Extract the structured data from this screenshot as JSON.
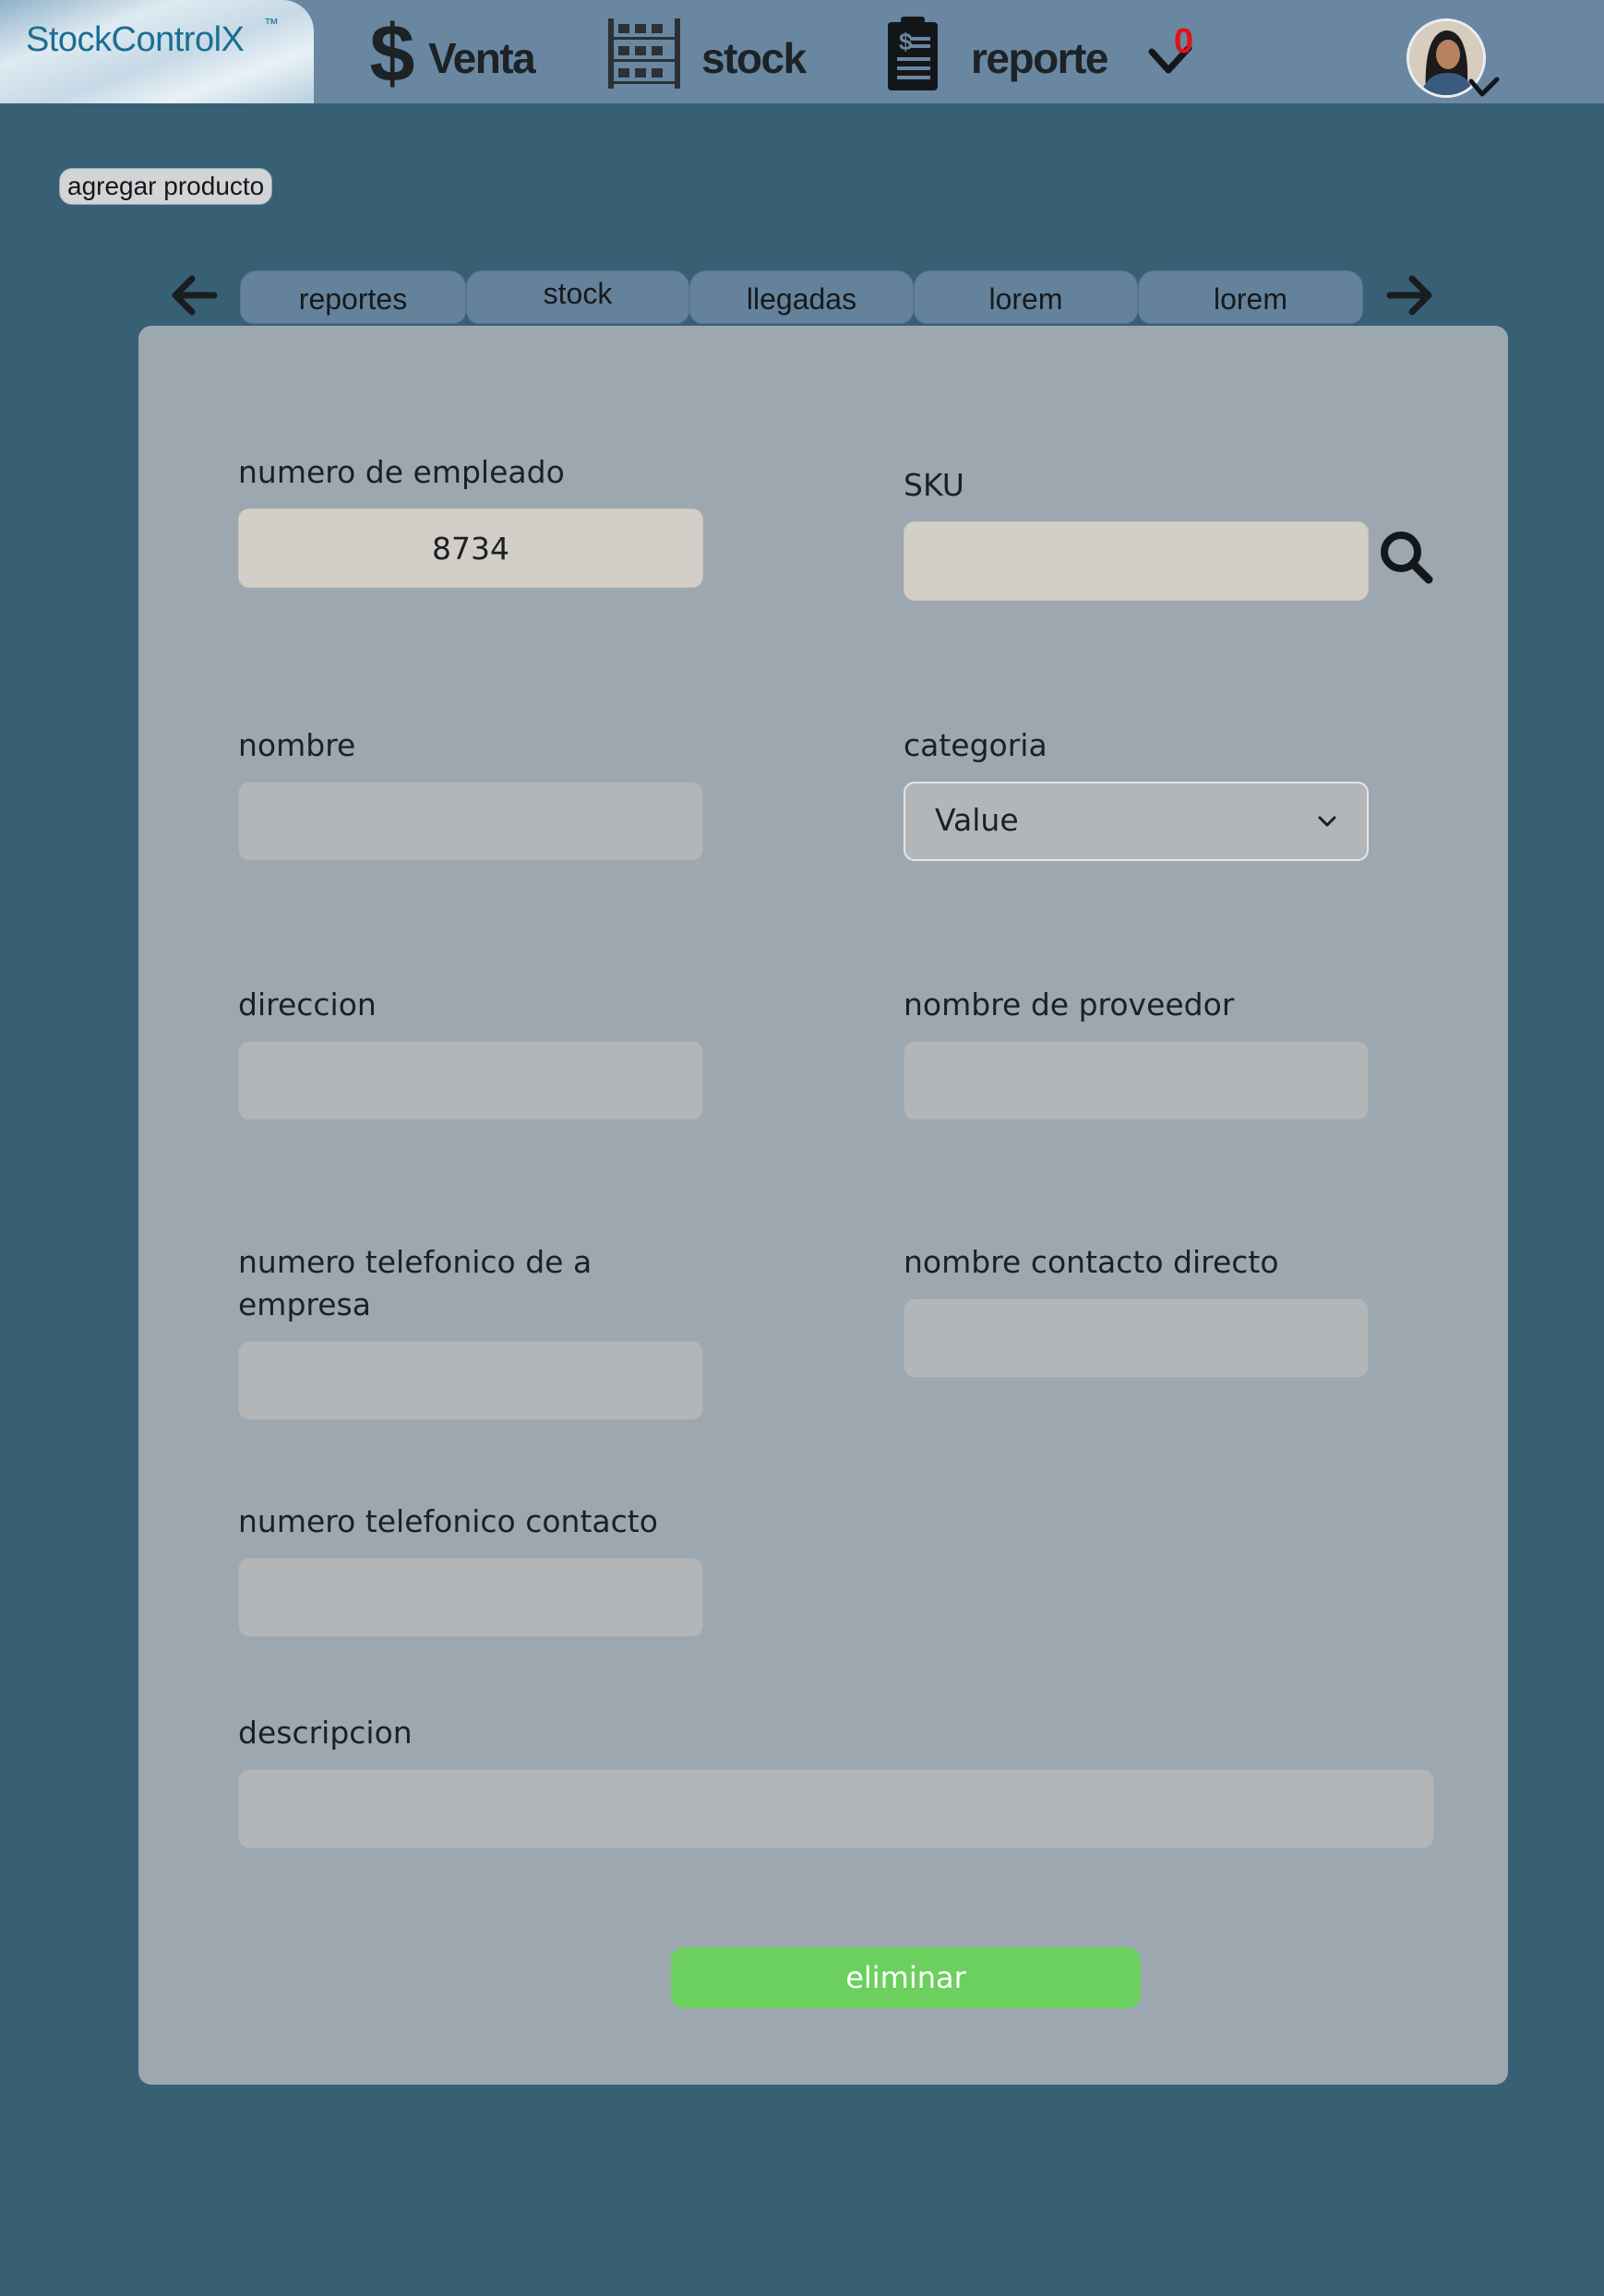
{
  "app": {
    "logo_text": "StockControlX",
    "logo_mark": "™"
  },
  "nav": {
    "items": [
      {
        "label": "Venta",
        "icon": "dollar-icon"
      },
      {
        "label": "stock",
        "icon": "shelf-icon"
      },
      {
        "label": "reporte",
        "icon": "report-icon"
      }
    ],
    "notification_count": "0"
  },
  "actions": {
    "add_product": "agregar producto"
  },
  "tabs": [
    {
      "label": "reportes"
    },
    {
      "label": "stock",
      "active": true
    },
    {
      "label": "llegadas"
    },
    {
      "label": "lorem"
    },
    {
      "label": "lorem"
    }
  ],
  "form": {
    "employee_number": {
      "label": "numero de empleado",
      "value": "8734"
    },
    "sku": {
      "label": "SKU",
      "value": ""
    },
    "name": {
      "label": "nombre",
      "value": ""
    },
    "category": {
      "label": "categoria",
      "value": "Value"
    },
    "address": {
      "label": "direccion",
      "value": ""
    },
    "supplier_name": {
      "label": "nombre de proveedor",
      "value": ""
    },
    "company_phone": {
      "label_line1": "numero telefonico de a",
      "label_line2": "empresa",
      "value": ""
    },
    "direct_contact": {
      "label": "nombre contacto directo",
      "value": ""
    },
    "contact_phone": {
      "label": "numero telefonico contacto",
      "value": ""
    },
    "description": {
      "label": "descripcion",
      "value": ""
    },
    "submit_label": "eliminar"
  },
  "colors": {
    "background": "#376075",
    "topbar": "#6a87a1",
    "card": "#9ca7b0",
    "submit": "#6bd05d",
    "badge": "#e2101c"
  }
}
